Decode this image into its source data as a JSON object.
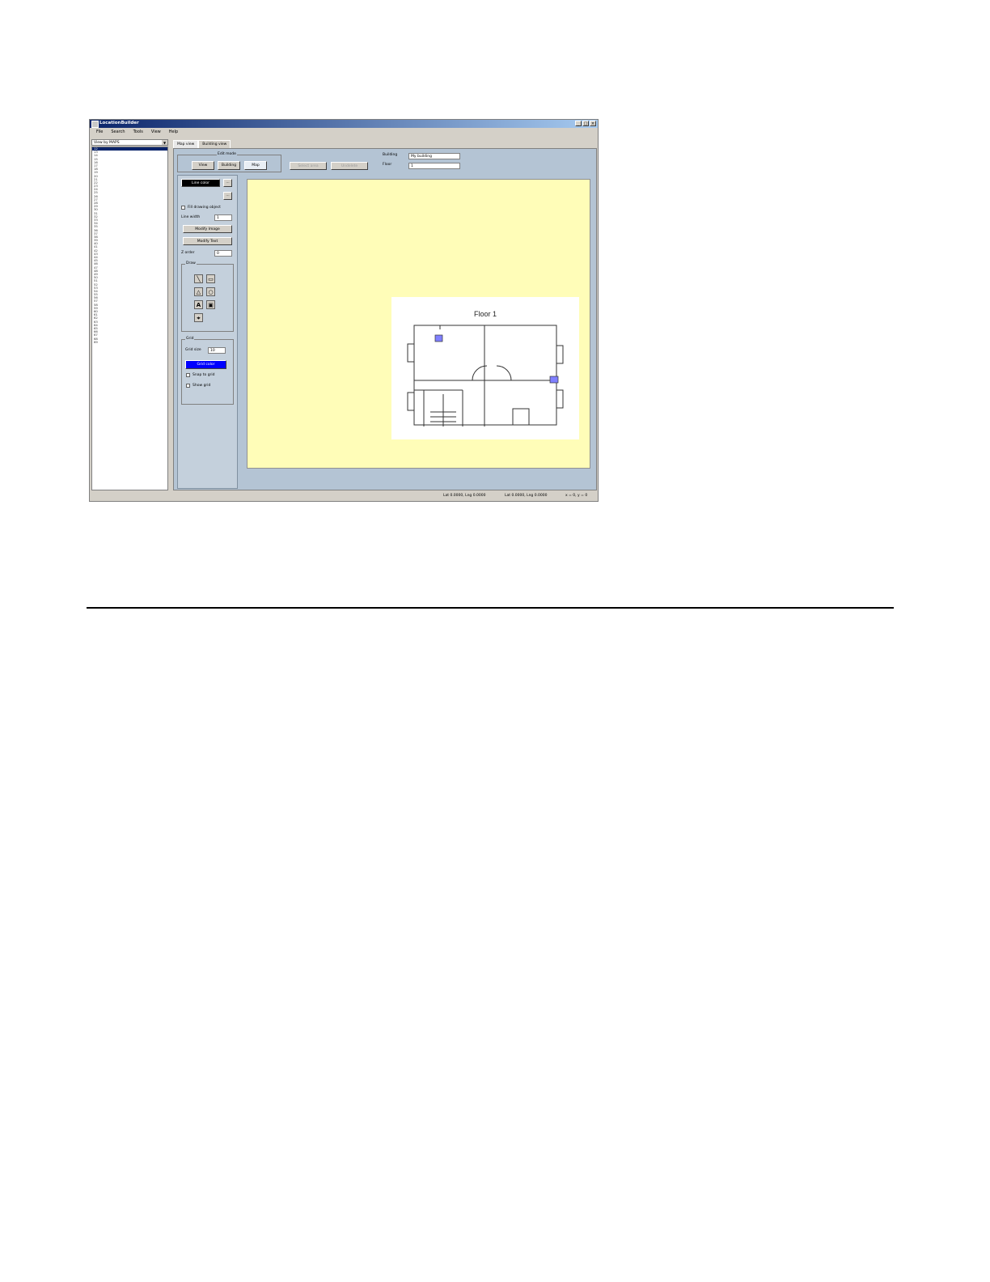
{
  "app": {
    "title": "LocationBuilder",
    "window_controls": [
      "_",
      "□",
      "×"
    ],
    "menu": [
      "File",
      "Search",
      "Tools",
      "View",
      "Help"
    ]
  },
  "sidebar": {
    "view_select": "View by MAPS",
    "items": [
      "12",
      "13",
      "14",
      "15",
      "16",
      "17",
      "18",
      "19",
      "20",
      "21",
      "22",
      "23",
      "24",
      "25",
      "26",
      "27",
      "28",
      "29",
      "30",
      "31",
      "32",
      "33",
      "34",
      "35",
      "36",
      "37",
      "38",
      "39",
      "40",
      "41",
      "42",
      "43",
      "44",
      "45",
      "46",
      "47",
      "48",
      "49",
      "50",
      "51",
      "52",
      "53",
      "54",
      "55",
      "56",
      "57",
      "58",
      "59",
      "60",
      "61",
      "62",
      "63",
      "64",
      "65",
      "66",
      "67",
      "68",
      "69"
    ]
  },
  "tabs": [
    "Map view",
    "Building view"
  ],
  "toolbar": {
    "edit_mode_label": "Edit mode",
    "mode_buttons": [
      "View",
      "Building",
      "Map"
    ],
    "action_buttons": [
      "Select area",
      "Undelete"
    ],
    "building_label": "Building",
    "building_value": "My building",
    "floor_label": "Floor",
    "floor_value": "1"
  },
  "tools_panel": {
    "line_color": "Line color",
    "btn_small_1": "...",
    "btn_small_2": "...",
    "fill_label": "Fill drawing object",
    "line_width_label": "Line width",
    "line_width_value": "1",
    "modify_image": "Modify Image",
    "modify_text": "Modify Text",
    "zorder_label": "Z order",
    "zorder_value": "0",
    "draw_group": "Draw",
    "grid_group": "Grid",
    "grid_size_label": "Grid size",
    "grid_size_value": "10",
    "grid_color": "Grid color",
    "snap_grid": "Snap to grid",
    "show_grid": "Show grid"
  },
  "canvas": {
    "map_title": "Floor 1"
  },
  "statusbar": {
    "left": "Lat 0.0000, Lng 0.0000",
    "mid": "Lat 0.0000, Lng 0.0000",
    "right": "x = 0, y = 0"
  },
  "colors": {
    "title_start": "#0a246a",
    "title_end": "#a6caf0",
    "canvas_bg": "#fffdb8",
    "panel_bg": "#b4c4d4",
    "line_color_btn": "#000000",
    "grid_color_btn": "#0000ff",
    "marker": "#8080ff"
  }
}
